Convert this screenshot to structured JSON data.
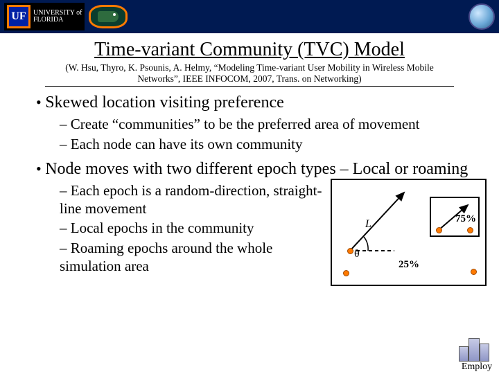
{
  "header": {
    "uf_initials": "UF",
    "uf_line1": "UNIVERSITY of",
    "uf_line2": "FLORIDA"
  },
  "title": "Time-variant Community (TVC) Model",
  "citation_line1": "(W. Hsu, Thyro, K. Psounis, A. Helmy, “Modeling Time-variant User Mobility in Wireless Mobile",
  "citation_line2": "Networks”, IEEE INFOCOM, 2007, Trans. on Networking)",
  "bullets": {
    "b1": "Skewed location visiting preference",
    "b1_subs": {
      "s1": "Create “communities” to be the preferred area of movement",
      "s2": "Each node can have its own community"
    },
    "b2": "Node moves with two different epoch types – Local or roaming",
    "b2_subs": {
      "s1": "Each epoch is a random-direction, straight-line movement",
      "s2": "Local epochs in the community",
      "s3": "Roaming epochs around the whole simulation area"
    }
  },
  "diagram": {
    "length_label": "L",
    "angle_label": "θ",
    "inner_percent": "75%",
    "outer_percent": "25%"
  },
  "footer_label": "Employ"
}
